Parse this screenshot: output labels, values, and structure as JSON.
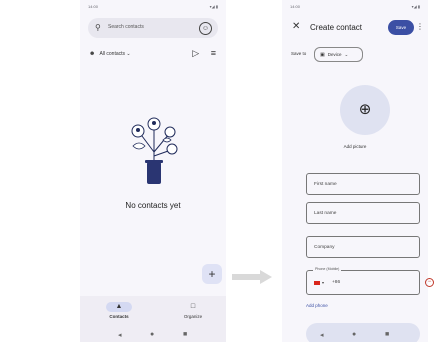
{
  "left_screen": {
    "status": {
      "time": "14:00",
      "icons": "▾◢ ▮"
    },
    "search": {
      "placeholder": "Search contacts",
      "icon": "search-icon",
      "avatar_icon": "account-circle-icon"
    },
    "account_filter": {
      "label": "All contacts",
      "icon": "people-icon",
      "chevron": "⌄"
    },
    "toolbar": {
      "label_icon": "▷",
      "filter_icon": "≡"
    },
    "empty_state": {
      "message": "No contacts yet"
    },
    "fab": {
      "label": "+"
    },
    "bottom_nav": {
      "items": [
        {
          "label": "Contacts",
          "icon": "▲",
          "active": true
        },
        {
          "label": "Organize",
          "icon": "□",
          "active": false
        }
      ]
    },
    "system_nav": {
      "back": "◂",
      "home": "●",
      "recents": "■"
    }
  },
  "right_screen": {
    "status": {
      "time": "14:00",
      "icons": "▾◢ ▮"
    },
    "header": {
      "close": "✕",
      "title": "Create contact",
      "save_label": "Save",
      "more": "⋮"
    },
    "save_to": {
      "label": "Save to",
      "device_label": "Device",
      "chevron": "⌄"
    },
    "photo": {
      "icon": "⊕",
      "add_picture_label": "Add picture"
    },
    "fields": {
      "first_name": "First name",
      "last_name": "Last name",
      "company": "Company"
    },
    "phone": {
      "legend": "Phone (Mobile)",
      "country_code": "+86",
      "dropdown": "▾",
      "remove": "−"
    },
    "add_phone_label": "Add phone",
    "system_nav": {
      "back": "◂",
      "home": "●",
      "recents": "■"
    }
  },
  "colors": {
    "accent": "#3b4fa4",
    "surface": "#f7f6fb",
    "nav_active": "#d4d9f2",
    "remove": "#c0392b"
  }
}
